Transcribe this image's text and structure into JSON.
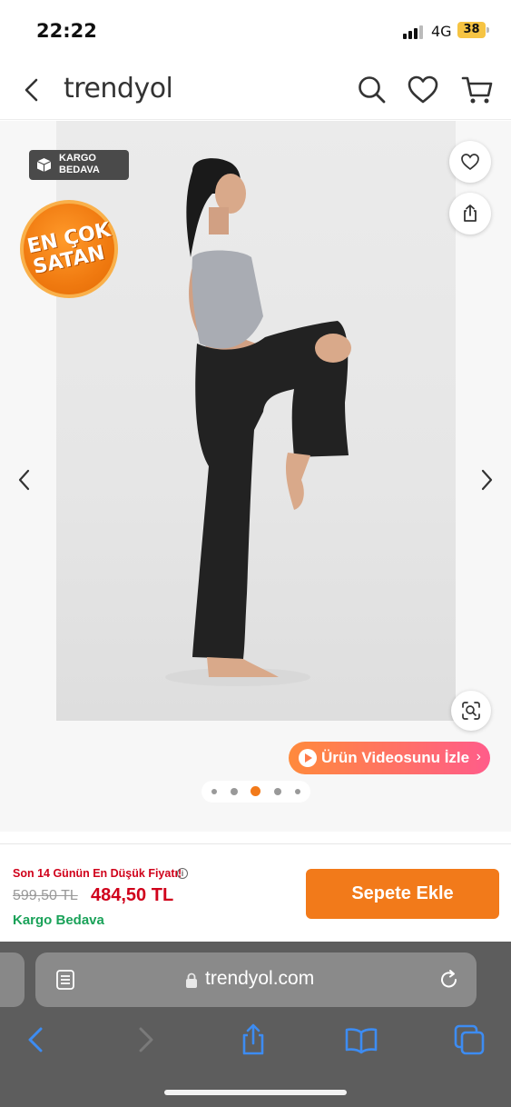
{
  "status": {
    "time": "22:22",
    "network": "4G",
    "battery": "38"
  },
  "header": {
    "logo": "trendyol"
  },
  "gallery": {
    "kargo_badge": [
      "KARGO",
      "BEDAVA"
    ],
    "seller_badge": [
      "EN ÇOK",
      "SATAN"
    ],
    "video_label": "Ürün Videosunu İzle",
    "total_images": 5,
    "active_image": 3
  },
  "cart": {
    "lowest_label": "Son 14 Günün En Düşük Fiyatı!",
    "old_price": "599,50 TL",
    "new_price": "484,50 TL",
    "cargo_free": "Kargo Bedava",
    "add_button": "Sepete Ekle"
  },
  "browser": {
    "url": "trendyol.com"
  },
  "colors": {
    "accent": "#f27a1a",
    "price_red": "#d0021b",
    "cargo_green": "#1aa259"
  }
}
